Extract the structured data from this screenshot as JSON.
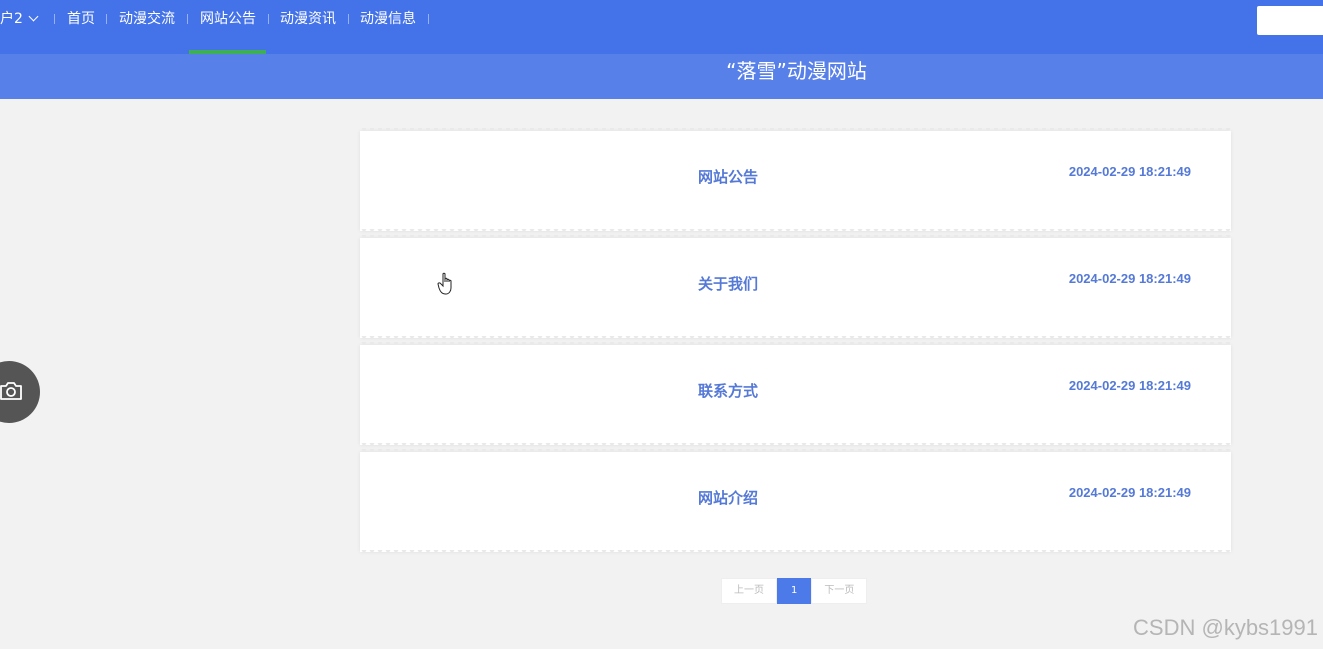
{
  "nav": {
    "user_label": "户2",
    "items": [
      {
        "label": "首页"
      },
      {
        "label": "动漫交流"
      },
      {
        "label": "网站公告"
      },
      {
        "label": "动漫资讯"
      },
      {
        "label": "动漫信息"
      }
    ],
    "active_item": "网站公告",
    "search_value": ""
  },
  "header": {
    "site_title": "“落雪”动漫网站"
  },
  "notices": [
    {
      "title": "网站公告",
      "time": "2024-02-29 18:21:49"
    },
    {
      "title": "关于我们",
      "time": "2024-02-29 18:21:49"
    },
    {
      "title": "联系方式",
      "time": "2024-02-29 18:21:49"
    },
    {
      "title": "网站介绍",
      "time": "2024-02-29 18:21:49"
    }
  ],
  "pagination": {
    "prev_label": "上一页",
    "current_page": "1",
    "next_label": "下一页"
  },
  "watermark": "CSDN @kybs1991",
  "icons": {
    "user_menu": "chevron-down-icon",
    "floating": "camera-icon"
  },
  "colors": {
    "nav_bg": "#4472e8",
    "title_band_bg": "#5880e9",
    "active_indicator": "#3fae58",
    "accent_text": "#5579d6",
    "current_page_bg": "#4c7be9"
  }
}
